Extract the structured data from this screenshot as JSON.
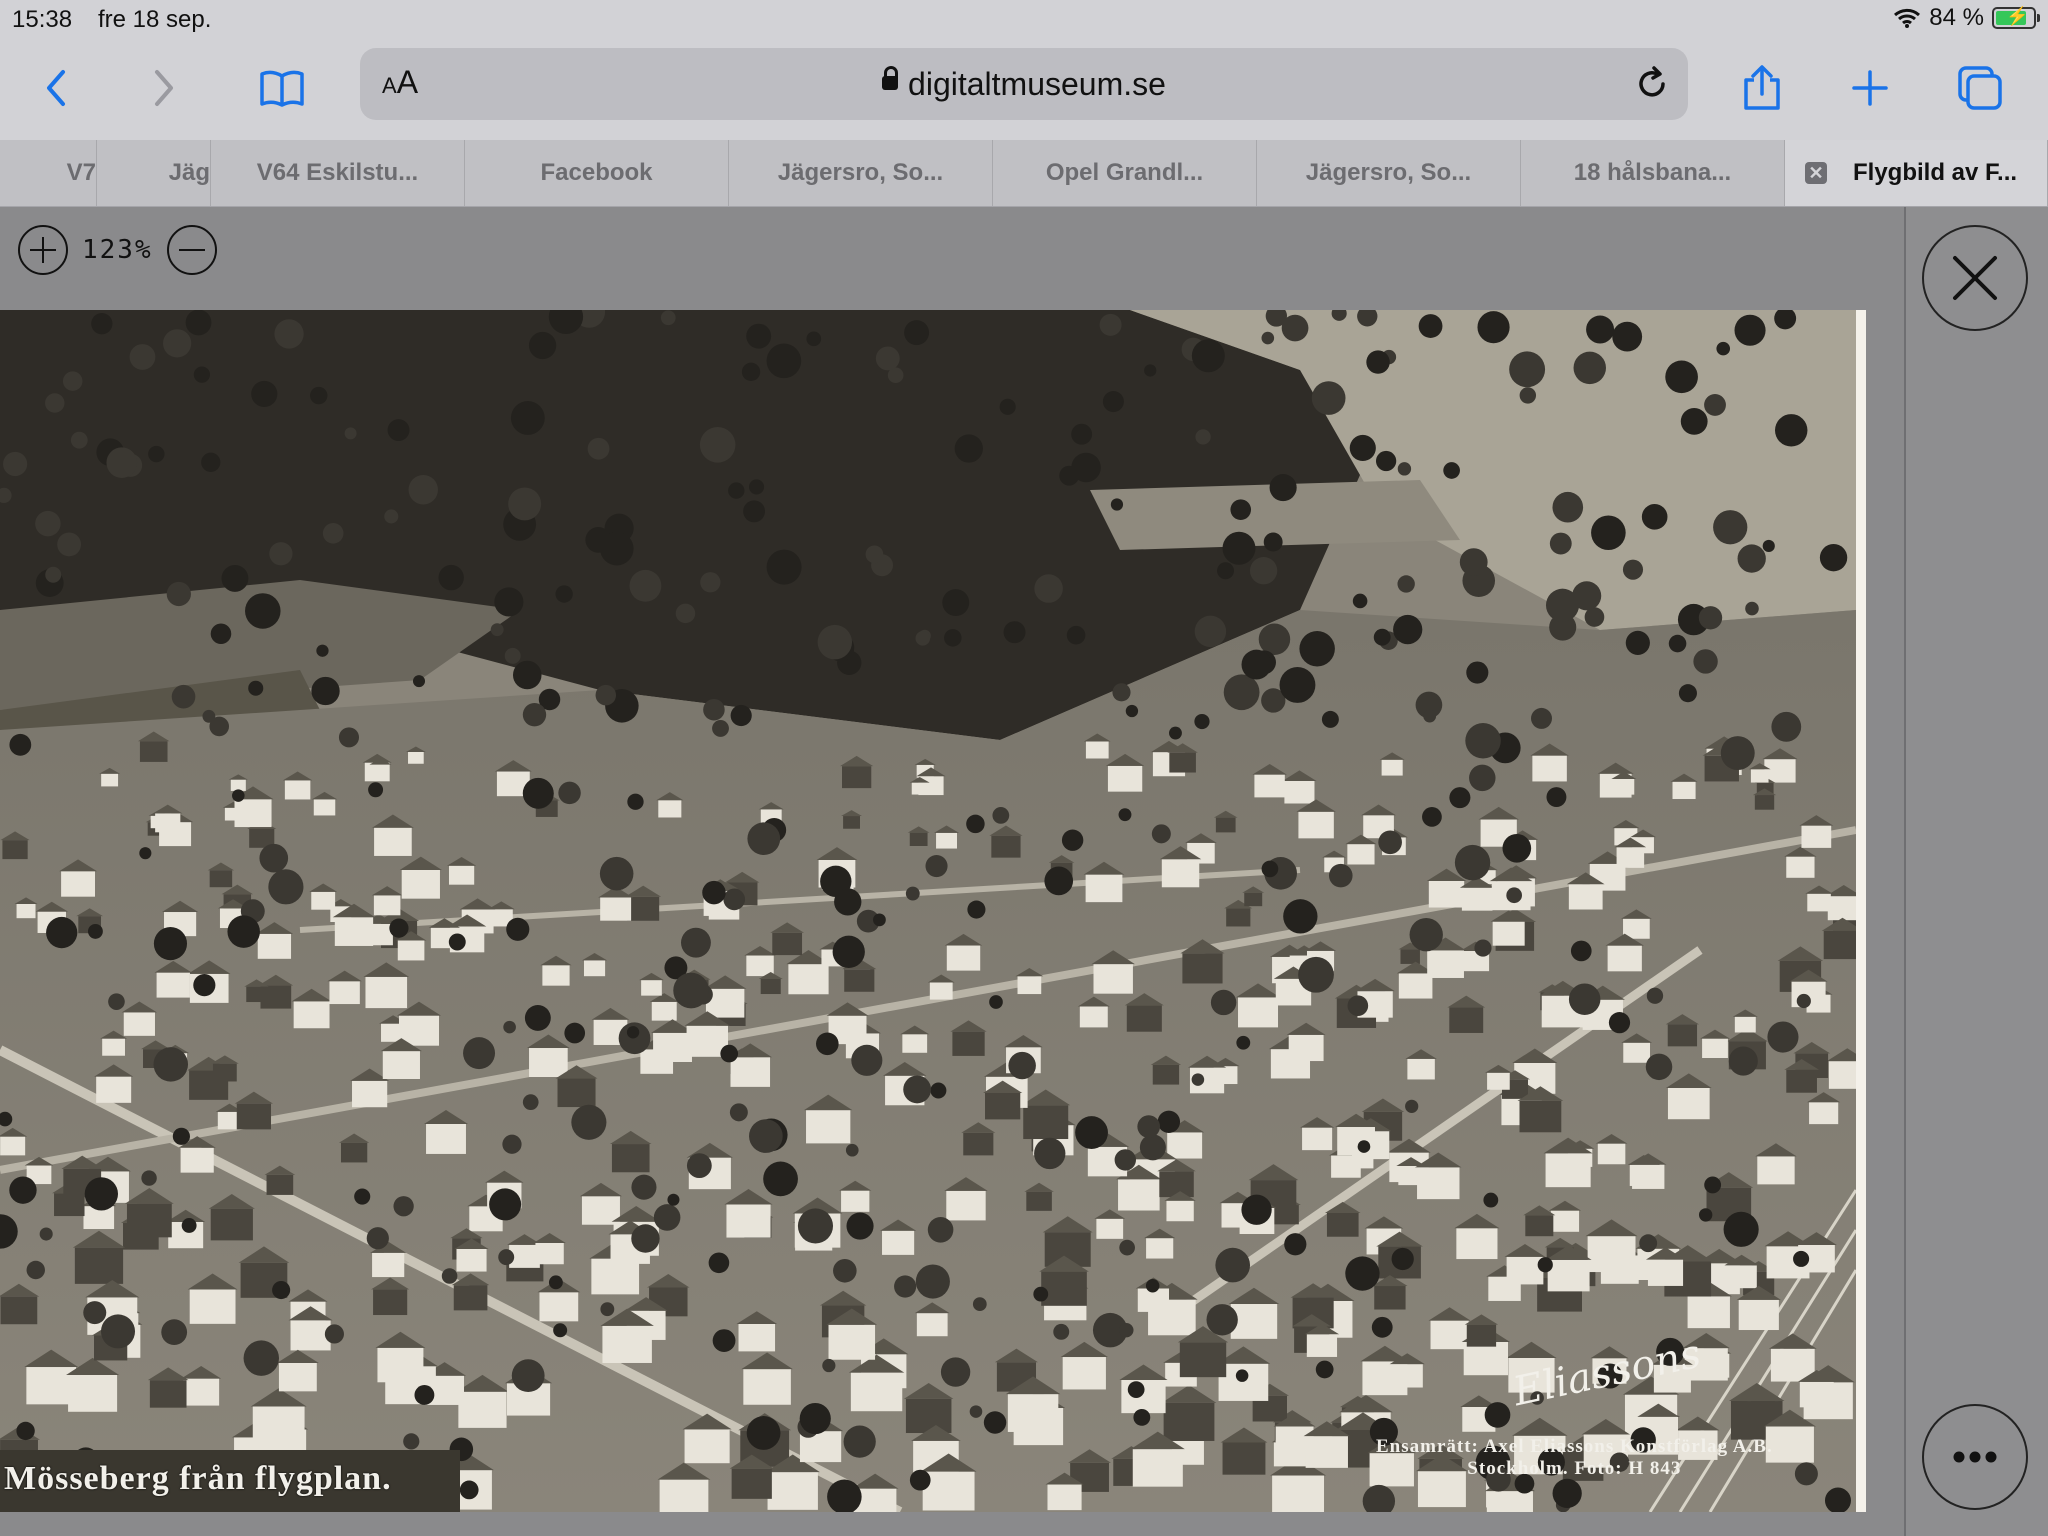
{
  "status": {
    "time": "15:38",
    "date": "fre 18 sep.",
    "battery_percent_label": "84 %",
    "battery_level": 0.84,
    "icons": [
      "wifi-icon",
      "battery-charging-icon"
    ]
  },
  "toolbar": {
    "url": "digitaltmuseum.se",
    "text_size_label_small": "A",
    "text_size_label_large": "A",
    "icons": [
      "back-icon",
      "forward-icon",
      "bookmarks-icon",
      "lock-icon",
      "reload-icon",
      "share-icon",
      "new-tab-icon",
      "tabs-overview-icon"
    ]
  },
  "tabs": [
    {
      "label": "V7"
    },
    {
      "label": "Jäg"
    },
    {
      "label": "V64 Eskilstu..."
    },
    {
      "label": "Facebook"
    },
    {
      "label": "Jägersro, So..."
    },
    {
      "label": "Opel Grandl..."
    },
    {
      "label": "Jägersro, So..."
    },
    {
      "label": "18 hålsbana..."
    },
    {
      "label": "Flygbild av F...",
      "active": true
    }
  ],
  "viewer": {
    "zoom_label": "123%",
    "icons": [
      "zoom-in-icon",
      "zoom-out-icon",
      "close-icon",
      "more-icon"
    ]
  },
  "photo": {
    "caption": "Mösseberg från flygplan.",
    "signature": "Eliassons",
    "credit_line1": "Ensamrätt: Axel Eliassons Konstförlag A.B.",
    "credit_line2": "Stockholm.    Foto: H 843"
  },
  "colors": {
    "accent": "#1a73e8",
    "chrome": "#d2d2d6",
    "tabbar": "#c0c0c4",
    "viewer_bg": "#8a8a8c",
    "battery_fill": "#35c759"
  }
}
